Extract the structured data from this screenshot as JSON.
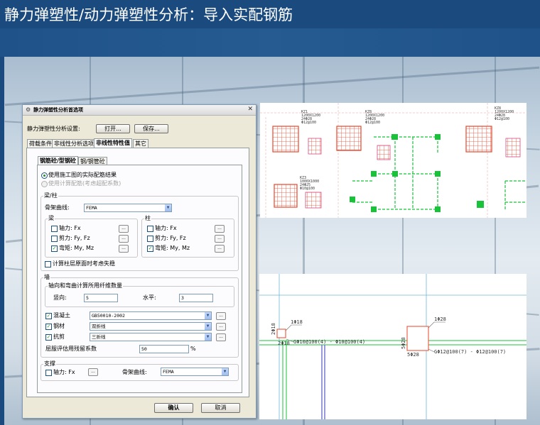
{
  "slide": {
    "title": "静力弹塑性/动力弹塑性分析：导入实配钢筋"
  },
  "dialog": {
    "title": "静力弹塑性分析首选项",
    "settings_label": "静力弹塑性分析设置:",
    "open_button": "打开...",
    "save_button": "保存...",
    "tabs": [
      "荷载条件",
      "非线性分析选项",
      "非线性特性值",
      "其它"
    ],
    "subtabs": [
      "钢筋砼/型钢砼",
      "钢/钢管砼"
    ],
    "radio_use_actual": "使用施工图的实际配筋结果",
    "radio_use_calc": "使用计算配筋(考虑超配系数)",
    "beam_col": {
      "title": "梁/柱",
      "curve_label": "骨架曲线:",
      "curve_value": "FEMA",
      "beam": {
        "title": "梁",
        "axial": "轴力: Fx",
        "shear": "剪力: Fy, Fz",
        "moment": "弯矩: My, Mz"
      },
      "column": {
        "title": "柱",
        "axial": "轴力: Fx",
        "shear": "剪力: Fy, Fz",
        "moment": "弯矩: My, Mz"
      },
      "instability_label": "计算柱层原面时考虑失稳"
    },
    "wall": {
      "title": "墙",
      "fiber_label": "轴向和弯曲计算所用纤维数量",
      "vertical_label": "竖向:",
      "vertical_value": "5",
      "horizontal_label": "水平:",
      "horizontal_value": "3",
      "concrete_label": "混凝土",
      "concrete_value": "GB50010-2002",
      "steel_label": "钢材",
      "steel_value": "双折线",
      "shear_label": "抗剪",
      "shear_value": "三折线",
      "residual_label": "屈服评估用残留系数",
      "residual_value": "50",
      "residual_unit": "%"
    },
    "brace": {
      "title": "支撑",
      "axial": "轴力: Fx",
      "curve_label": "骨架曲线:",
      "curve_value": "FEMA"
    },
    "ok_button": "确认",
    "cancel_button": "取消"
  },
  "drawing_top": {
    "col_labels": [
      {
        "id": "KZ1",
        "dim": "1200X1200",
        "bars": "24Φ28",
        "stirrup": "Φ12@100"
      },
      {
        "id": "KZ8",
        "dim": "1200X1200",
        "bars": "24Φ28",
        "stirrup": "Φ12@100"
      },
      {
        "id": "KZ8",
        "dim": "1200X1200",
        "bars": "24Φ28",
        "stirrup": "Φ12@100"
      },
      {
        "id": "KZ3",
        "dim": "1000X1000",
        "bars": "24Φ25",
        "stirrup": "Φ10@100"
      }
    ]
  },
  "drawing_bottom": {
    "left_top": "1Φ18",
    "left_side": "2Φ18",
    "left_bottom": "2Φ18",
    "left_rebar": "GΦ10@100(4) - Φ10@100(4)",
    "right_top": "1Φ28",
    "right_side": "5Φ28",
    "right_bottom": "5Φ28",
    "right_rebar": "GΦ12@100(7) - Φ12@100(7)"
  },
  "colors": {
    "title_text": "#ffffff",
    "banner": "#1f5288",
    "column_red": "#e8452a",
    "beam_green": "#18c33a",
    "dimension_blue": "#6fb6d9"
  }
}
